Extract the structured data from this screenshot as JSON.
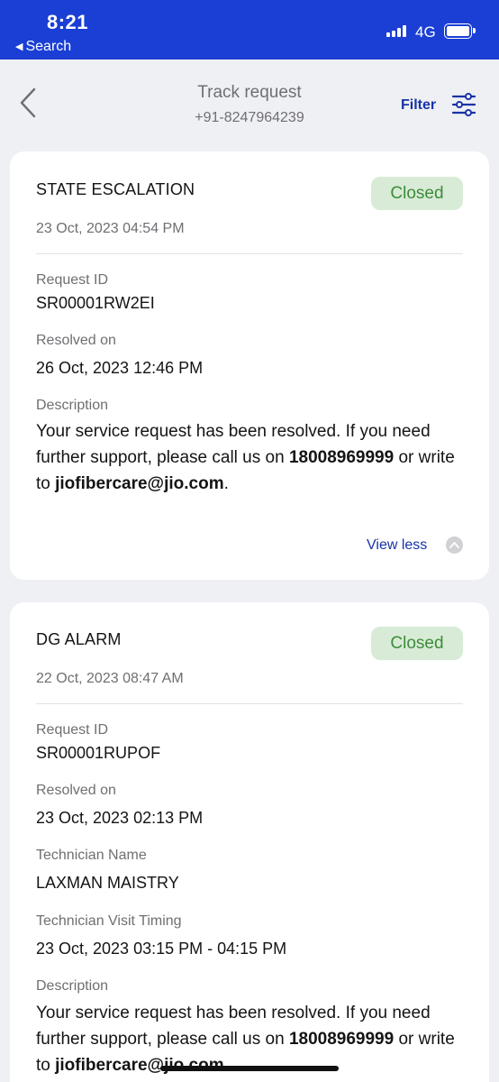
{
  "status_bar": {
    "time": "8:21",
    "back_label": "Search",
    "network": "4G"
  },
  "header": {
    "title": "Track request",
    "subtitle": "+91-8247964239",
    "filter_label": "Filter"
  },
  "requests": [
    {
      "title": "STATE ESCALATION",
      "status": "Closed",
      "date": "23 Oct, 2023 04:54 PM",
      "request_id_label": "Request ID",
      "request_id": "SR00001RW2EI",
      "resolved_label": "Resolved on",
      "resolved_on": "26 Oct, 2023 12:46 PM",
      "description_label": "Description",
      "description": {
        "part1": "Your service request has been resolved. If you need further support, please call us on ",
        "phone": "18008969999",
        "part2": " or write to ",
        "email": "jiofibercare@jio.com",
        "part3": "."
      },
      "toggle_label": "View less"
    },
    {
      "title": "DG ALARM",
      "status": "Closed",
      "date": "22 Oct, 2023 08:47 AM",
      "request_id_label": "Request ID",
      "request_id": "SR00001RUPOF",
      "resolved_label": "Resolved on",
      "resolved_on": "23 Oct, 2023 02:13 PM",
      "technician_label": "Technician Name",
      "technician": "LAXMAN MAISTRY",
      "visit_label": "Technician Visit Timing",
      "visit_timing": "23 Oct, 2023 03:15 PM - 04:15 PM",
      "description_label": "Description",
      "description": {
        "part1": "Your service request has been resolved. If you need further support, please call us on ",
        "phone": "18008969999",
        "part2": " or write to ",
        "email": "jiofibercare@jio.com",
        "part3": "."
      }
    }
  ],
  "icons": {
    "back": "chevron-left-icon",
    "filter": "sliders-icon",
    "toggle": "chevron-up-icon"
  },
  "colors": {
    "status_bar": "#1b3fd4",
    "link": "#1733a8",
    "badge_bg": "#d8ebd6",
    "badge_text": "#3c8c3a",
    "background": "#eff0f3"
  }
}
